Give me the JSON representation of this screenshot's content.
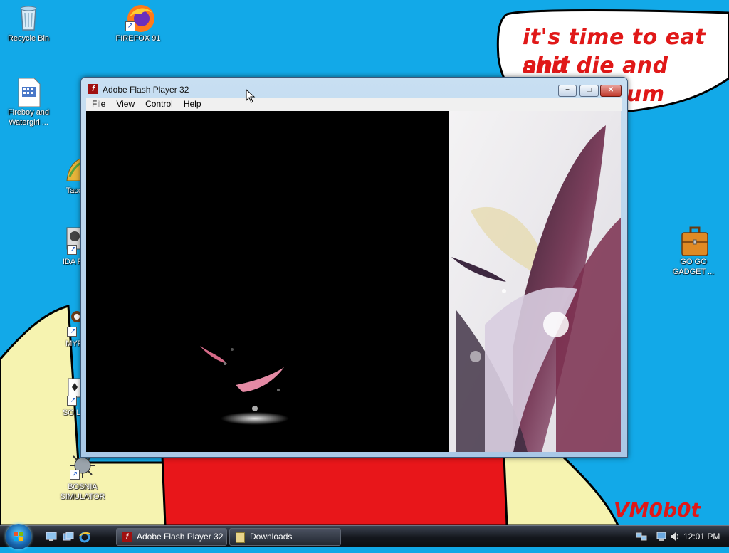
{
  "desktop": {
    "icons": [
      {
        "label": "Recycle Bin"
      },
      {
        "label": "FIREFOX 91"
      },
      {
        "label": "Fireboy and Watergirl ..."
      },
      {
        "label": "Taco"
      },
      {
        "label": "IDA P"
      },
      {
        "label": "MYP"
      },
      {
        "label": "SO LI"
      },
      {
        "label": "BOSNIA SIMULATOR"
      },
      {
        "label": "GO GO GADGET ..."
      }
    ],
    "speech_lines": [
      "it's time to eat shit",
      "and die and chew",
      "um"
    ],
    "signature": "VM0b0t"
  },
  "window": {
    "title": "Adobe Flash Player 32",
    "menu": [
      "File",
      "View",
      "Control",
      "Help"
    ],
    "minimize_glyph": "−",
    "maximize_glyph": "□",
    "close_glyph": "✕"
  },
  "taskbar": {
    "buttons": [
      {
        "label": "Adobe Flash Player 32"
      },
      {
        "label": "Downloads"
      }
    ],
    "clock": "12:01 PM"
  },
  "colors": {
    "desktop_bg": "#12a9e8",
    "wallpaper_red": "#e8161a",
    "wallpaper_cream": "#f6f3b0",
    "speech_text": "#e01818"
  }
}
